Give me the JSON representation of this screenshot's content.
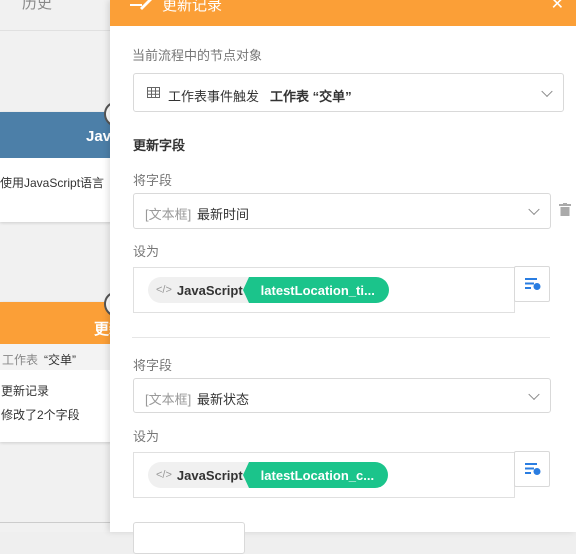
{
  "canvas": {
    "tab_label": "历史",
    "js_node": {
      "title": "JavaScr",
      "desc": "使用JavaScript语言"
    },
    "update_node": {
      "title": "更新",
      "sheet_prefix": "工作表",
      "sheet_name": "“交单”",
      "line1": "更新记录",
      "line2": "修改了2个字段"
    }
  },
  "panel": {
    "title": "更新记录",
    "node_object_label": "当前流程中的节点对象",
    "node_object": {
      "icon": "table-icon",
      "trigger": "工作表事件触发",
      "sheet": "工作表 “交单”"
    },
    "section_title": "更新字段",
    "fields": [
      {
        "field_label": "将字段",
        "field_type": "[文本框]",
        "field_name": "最新时间",
        "set_label": "设为",
        "source": "JavaScript",
        "value": "latestLocation_ti..."
      },
      {
        "field_label": "将字段",
        "field_type": "[文本框]",
        "field_name": "最新状态",
        "set_label": "设为",
        "source": "JavaScript",
        "value": "latestLocation_c..."
      }
    ]
  },
  "colors": {
    "accent": "#fb9f37",
    "js_node": "#4c7fa8",
    "field_pill": "#1bc48b"
  }
}
